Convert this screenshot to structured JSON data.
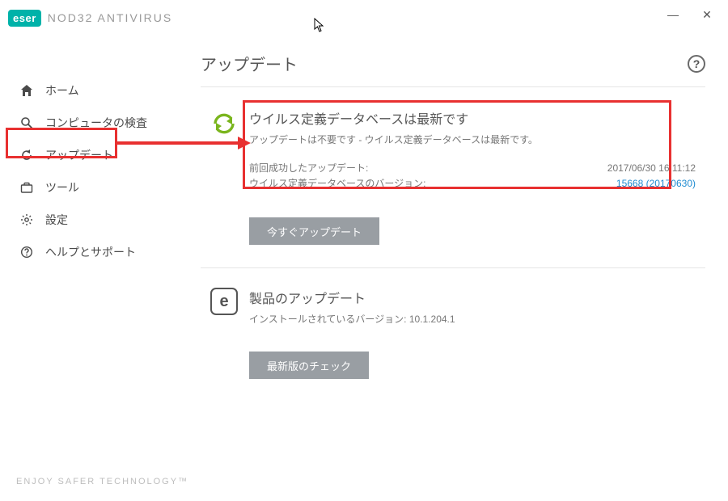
{
  "app": {
    "logo_text": "eser",
    "product": "NOD32 ANTIVIRUS"
  },
  "window_controls": {
    "minimize": "—",
    "close": "✕"
  },
  "sidebar": {
    "items": [
      {
        "label": "ホーム"
      },
      {
        "label": "コンピュータの検査"
      },
      {
        "label": "アップデート"
      },
      {
        "label": "ツール"
      },
      {
        "label": "設定"
      },
      {
        "label": "ヘルプとサポート"
      }
    ]
  },
  "main": {
    "page_title": "アップデート",
    "help_label": "?",
    "status_title": "ウイルス定義データベースは最新です",
    "status_desc": "アップデートは不要です - ウイルス定義データベースは最新です。",
    "last_update_label": "前回成功したアップデート:",
    "last_update_value": "2017/06/30 16:11:12",
    "db_ver_label": "ウイルス定義データベースのバージョン:",
    "db_ver_value": "15668 (20170630)",
    "update_now_btn": "今すぐアップデート",
    "product_update_title": "製品のアップデート",
    "installed_ver_label": "インストールされているバージョン: ",
    "installed_ver_value": "10.1.204.1",
    "check_latest_btn": "最新版のチェック",
    "product_logo_glyph": "e"
  },
  "footer": {
    "tagline": "ENJOY SAFER TECHNOLOGY™"
  }
}
